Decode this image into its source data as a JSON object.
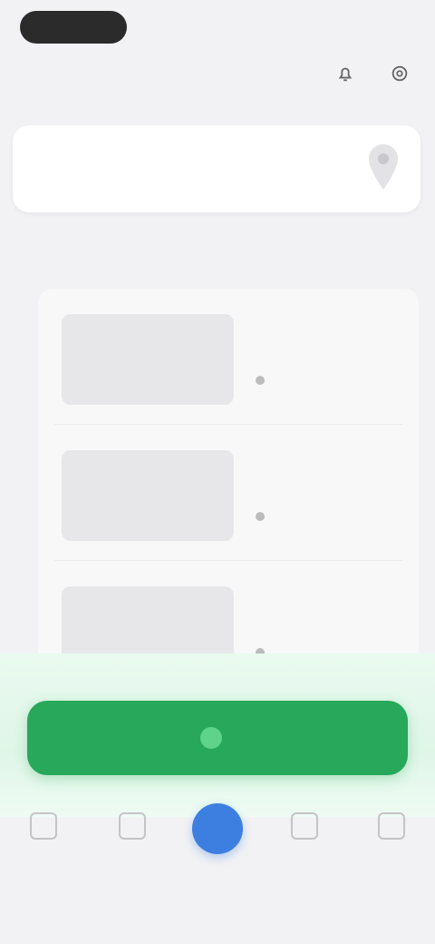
{
  "header": {
    "brand": "",
    "subtitle": "",
    "icons": [
      "bell-icon",
      "settings-icon"
    ]
  },
  "location": {
    "line1": "",
    "line2": "",
    "pin_icon": "map-pin-icon"
  },
  "section": {
    "title": ""
  },
  "items": [
    {
      "title": "",
      "meta": ""
    },
    {
      "title": "",
      "meta": ""
    },
    {
      "title": "",
      "meta": ""
    }
  ],
  "cta": {
    "label": "",
    "icon": "plus-icon",
    "color": "#27a85a"
  },
  "nav": {
    "items": [
      {
        "icon": "home-icon",
        "label": ""
      },
      {
        "icon": "search-icon",
        "label": ""
      },
      {
        "icon": "add-icon",
        "label": ""
      },
      {
        "icon": "inbox-icon",
        "label": ""
      },
      {
        "icon": "profile-icon",
        "label": ""
      }
    ],
    "accent": "#3d7fe0"
  }
}
